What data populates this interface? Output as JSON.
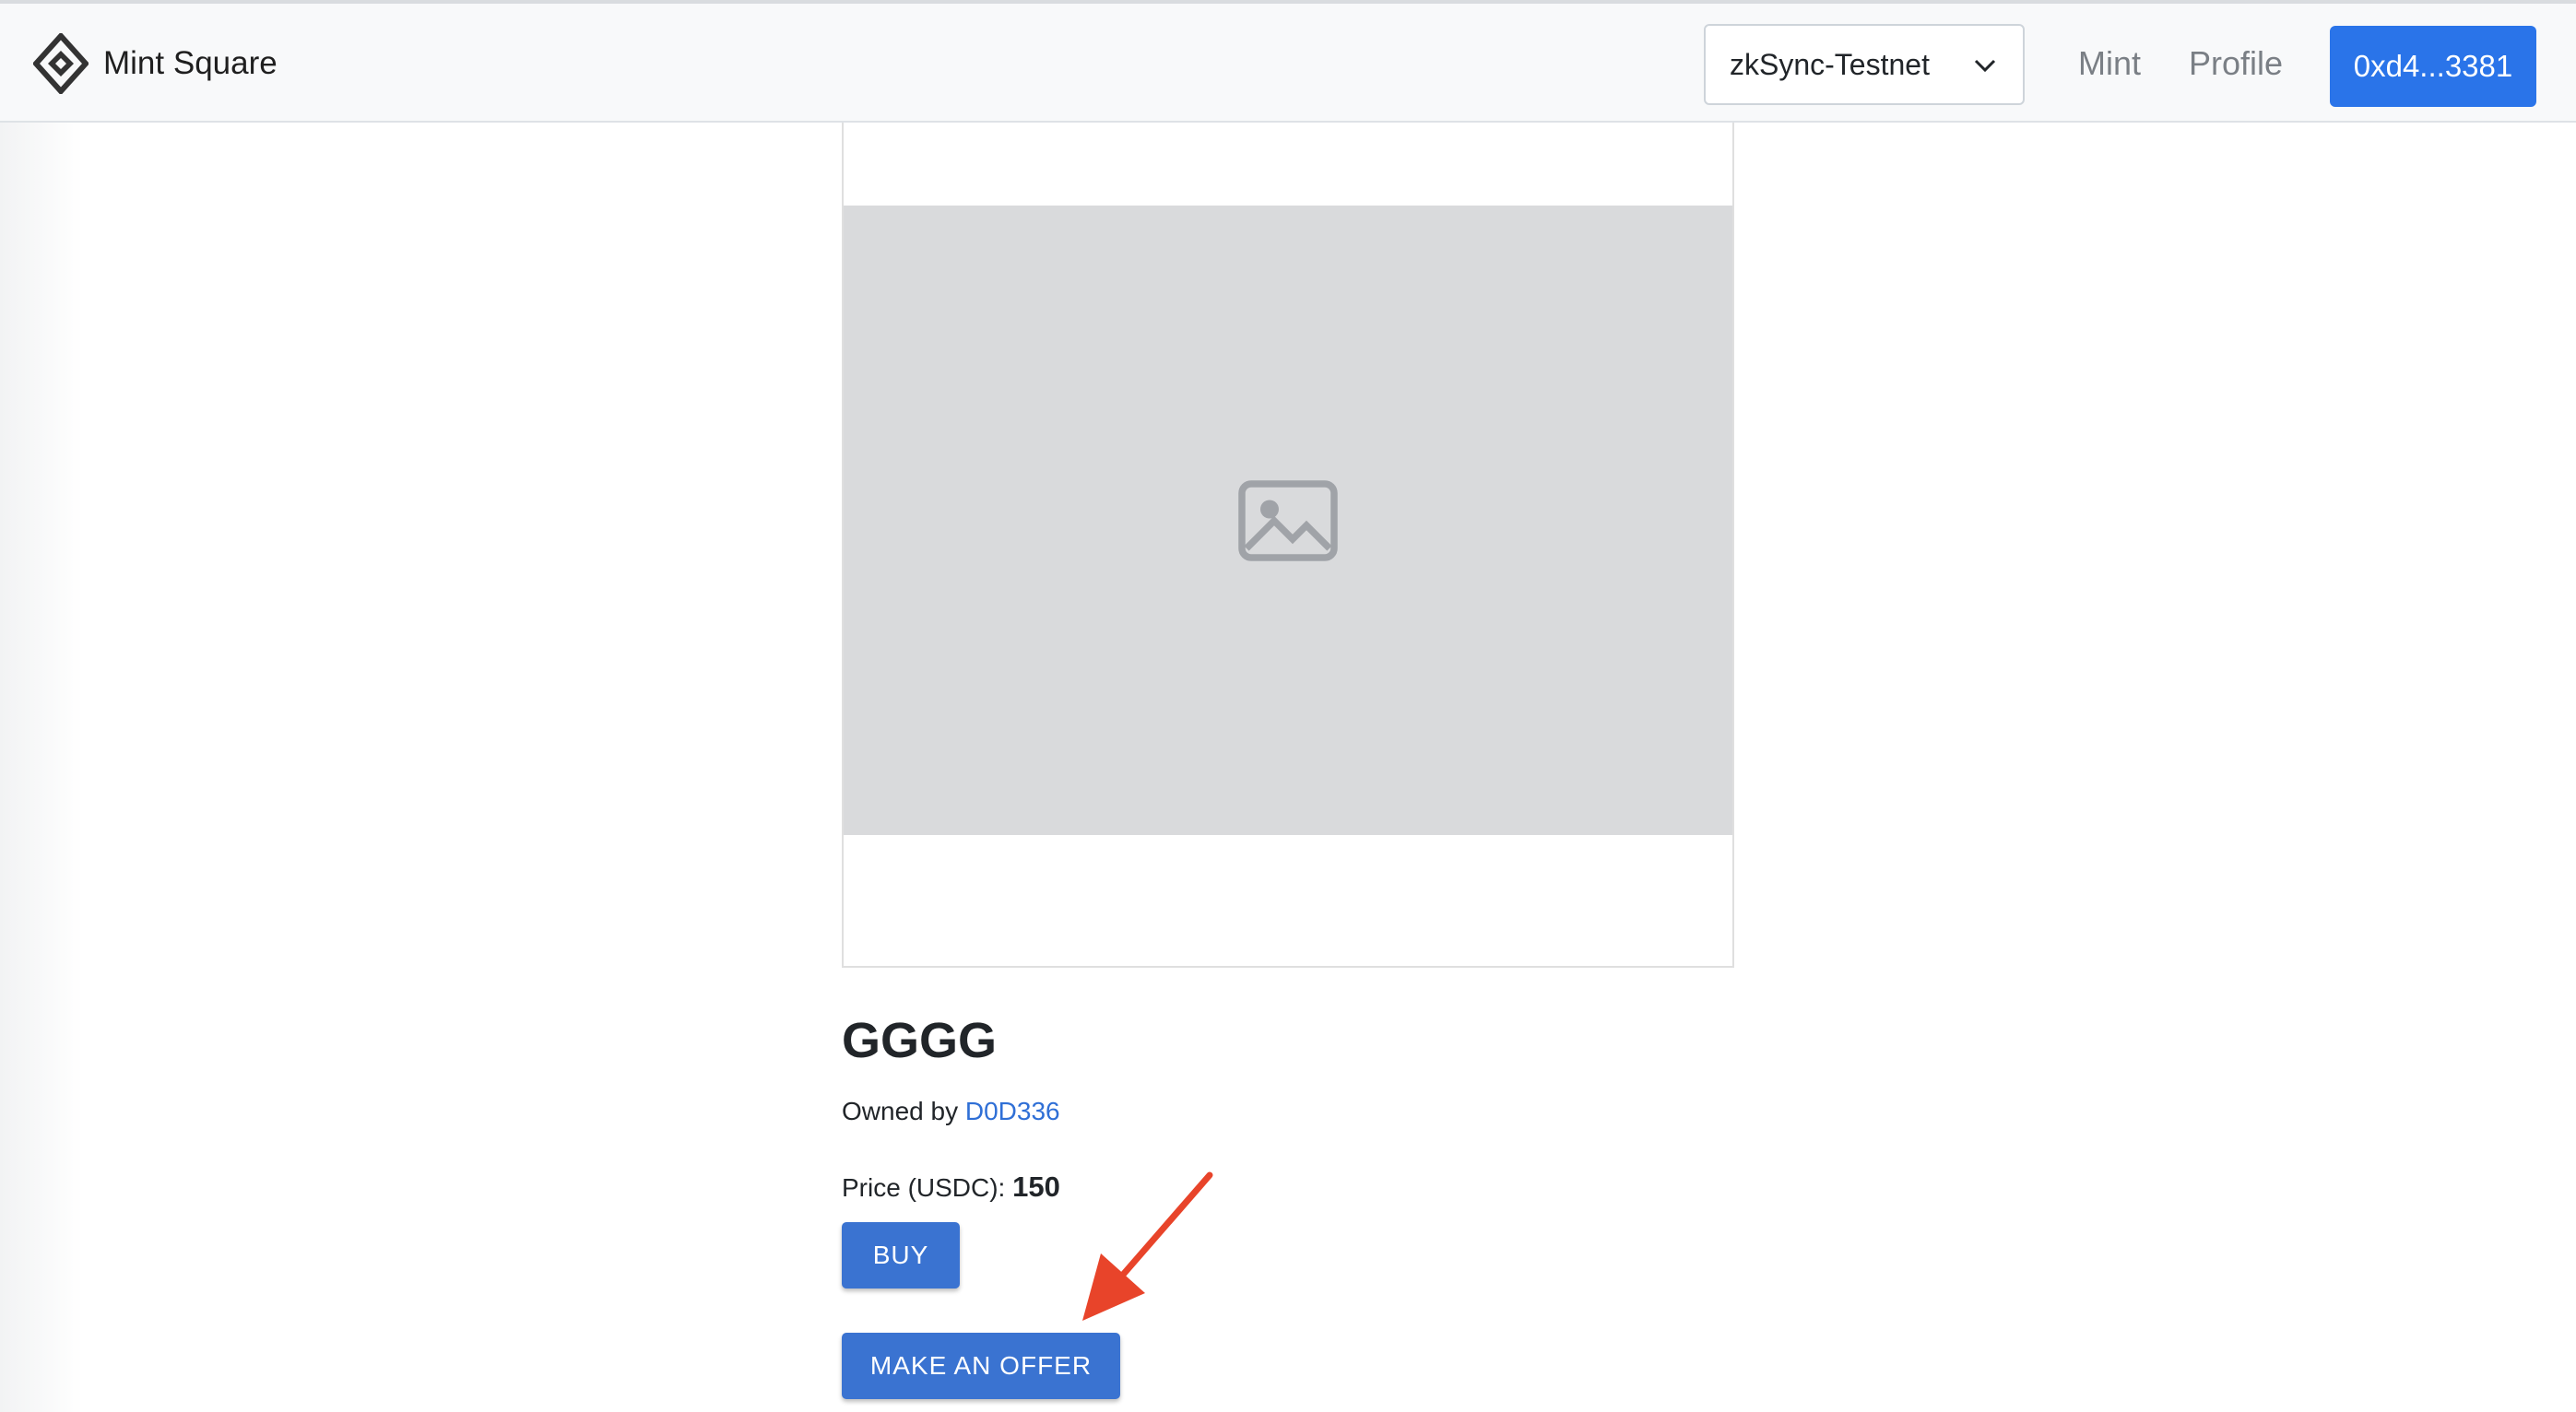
{
  "header": {
    "brand_name": "Mint Square",
    "logo_icon": "diamond-logo-icon",
    "network": {
      "selected": "zkSync-Testnet",
      "icon": "chevron-down-icon"
    },
    "nav": {
      "mint_label": "Mint",
      "profile_label": "Profile"
    },
    "wallet_label": "0xd4...3381",
    "accent_color": "#2a74e9"
  },
  "nft": {
    "title": "GGGG",
    "owned_prefix": "Owned by ",
    "owner_name": "D0D336",
    "price_label": "Price (USDC):",
    "price_value": "150"
  },
  "actions": {
    "buy_label": "BUY",
    "offer_label": "MAKE AN OFFER"
  },
  "annotation": {
    "arrow_color": "#e8442a"
  }
}
